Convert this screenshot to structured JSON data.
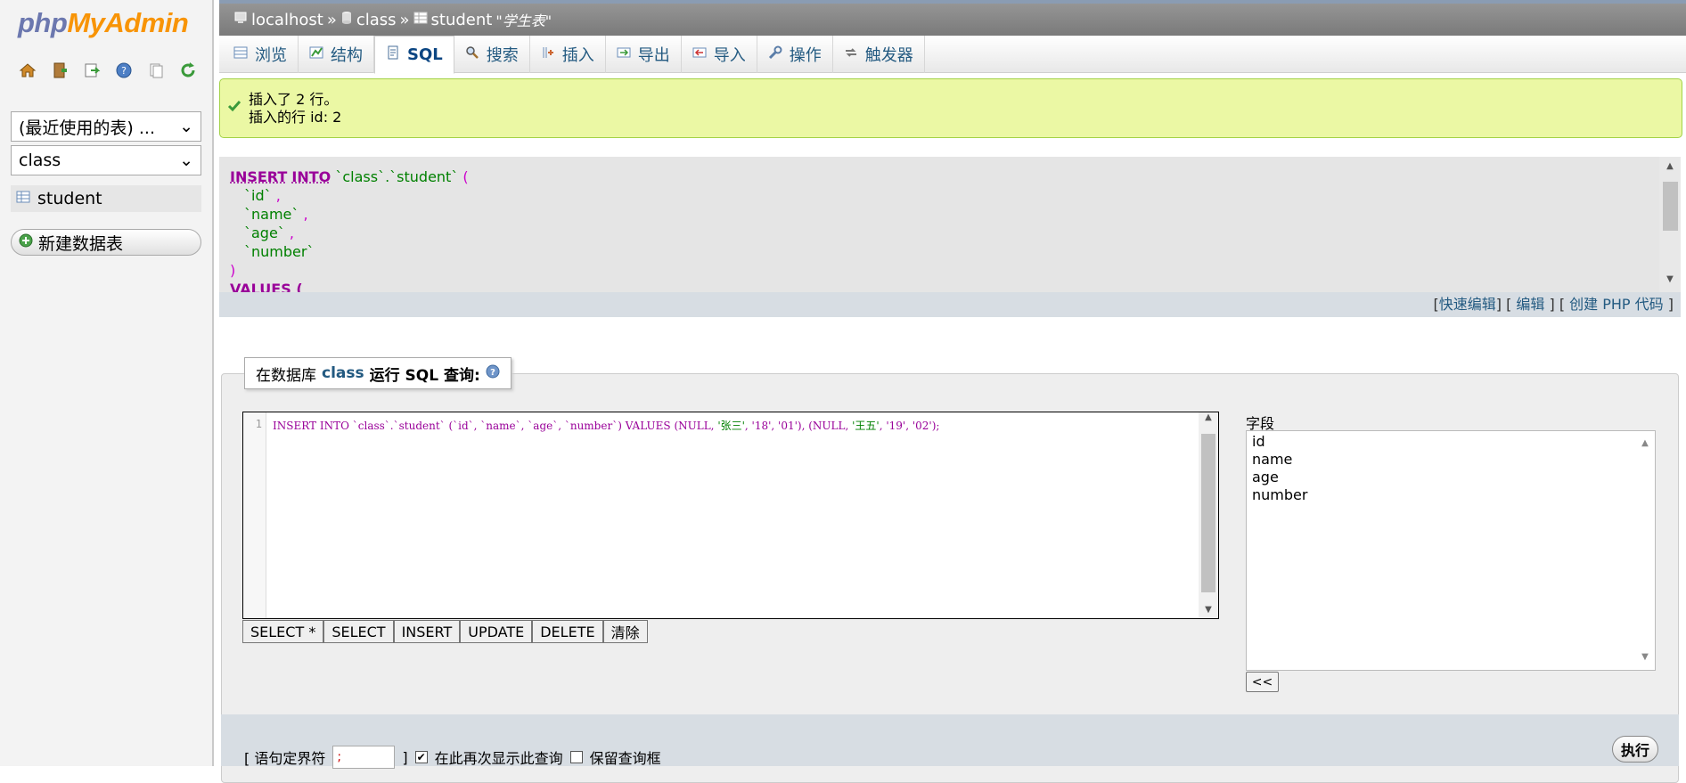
{
  "logo": {
    "php": "php",
    "myadmin": "MyAdmin"
  },
  "nav_icons": [
    "home-icon",
    "exit-icon",
    "sql-query-icon",
    "docs-icon",
    "copy-icon",
    "reload-icon"
  ],
  "sidebar": {
    "recent_tables": "(最近使用的表) ...",
    "database": "class",
    "table": "student",
    "new_table": "新建数据表"
  },
  "breadcrumb": {
    "server": "localhost",
    "sep": "»",
    "database": "class",
    "table": "student",
    "comment": "\"学生表\""
  },
  "tabs": [
    {
      "label": "浏览",
      "icon": "browse-icon"
    },
    {
      "label": "结构",
      "icon": "structure-icon"
    },
    {
      "label": "SQL",
      "icon": "sql-icon",
      "active": true
    },
    {
      "label": "搜索",
      "icon": "search-icon"
    },
    {
      "label": "插入",
      "icon": "insert-icon"
    },
    {
      "label": "导出",
      "icon": "export-icon"
    },
    {
      "label": "导入",
      "icon": "import-icon"
    },
    {
      "label": "操作",
      "icon": "wrench-icon"
    },
    {
      "label": "触发器",
      "icon": "triggers-icon"
    }
  ],
  "success": {
    "line1": "插入了 2 行。",
    "line2": "插入的行 id: 2"
  },
  "sql_display": {
    "insert": "INSERT",
    "into": "INTO",
    "table": "`class`.`student`",
    "open": "(",
    "cols": [
      "`id`",
      "`name`",
      "`age`",
      "`number`"
    ],
    "comma": ",",
    "close": ")",
    "values": "VALUES ("
  },
  "sql_links": {
    "quick_edit": "快速编辑",
    "edit": "编辑",
    "create_php": "创建 PHP 代码"
  },
  "query_panel": {
    "legend_prefix": "在数据库",
    "legend_db": "class",
    "legend_suffix": "运行 SQL 查询:",
    "line_number": "1",
    "code_a": "INSERT INTO `class`.`student` (`id`, `name`, `age`, `number`) VALUES (NULL, ",
    "code_s1": "'张三'",
    "code_b": ", '18', '01'), (NULL, ",
    "code_s2": "'王五'",
    "code_c": ", '19', '02');",
    "buttons": [
      "SELECT *",
      "SELECT",
      "INSERT",
      "UPDATE",
      "DELETE",
      "清除"
    ],
    "fields_label": "字段",
    "fields": [
      "id",
      "name",
      "age",
      "number"
    ],
    "insert_field": "<<"
  },
  "bottom": {
    "delimiter_label": "[ 语句定界符",
    "delimiter_value": ";",
    "delimiter_close": "]",
    "show_again": "在此再次显示此查询",
    "keep_box": "保留查询框",
    "go": "执行"
  },
  "colors": {
    "accent": "#235a81",
    "success_bg": "#ebf8a4",
    "keyword": "#990099",
    "string": "#008000"
  }
}
